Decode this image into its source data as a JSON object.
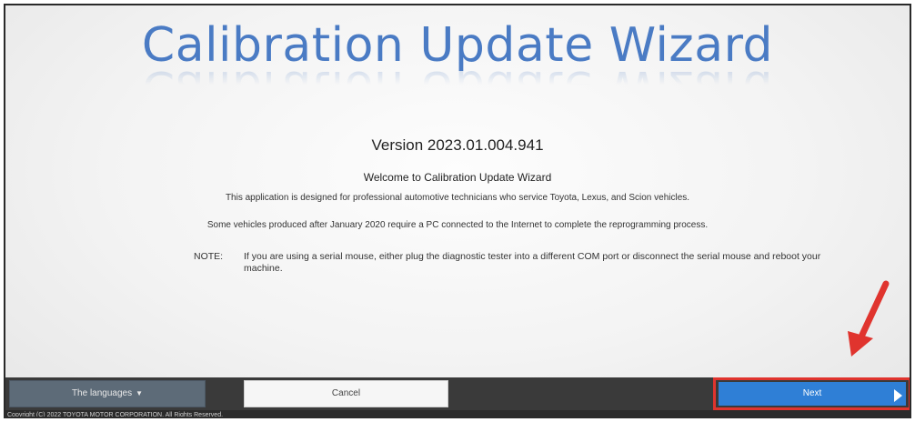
{
  "app": {
    "title": "Calibration Update Wizard",
    "version": "Version 2023.01.004.941",
    "welcome": "Welcome to Calibration Update Wizard",
    "description": "This application is designed for professional automotive technicians who service Toyota, Lexus, and Scion vehicles.",
    "internet_note": "Some vehicles produced after January 2020 require a PC connected to the Internet to complete the reprogramming process.",
    "note_label": "NOTE:",
    "note_text": "If you are using a serial mouse, either plug the diagnostic tester into a different COM port or disconnect the serial mouse and reboot your machine."
  },
  "footer": {
    "languages_label": "The languages",
    "languages_caret": "▼",
    "cancel_label": "Cancel",
    "next_label": "Next",
    "copyright": "Copyright (C) 2022 TOYOTA MOTOR CORPORATION. All Rights Reserved."
  },
  "colors": {
    "title_blue": "#4a7bc4",
    "next_blue": "#2f7fd6",
    "highlight_red": "#e0342e",
    "bar_dark": "#3a3a3a"
  },
  "annotations": {
    "arrow_icon": "red-arrow-icon",
    "highlight": "next-button-highlight"
  }
}
